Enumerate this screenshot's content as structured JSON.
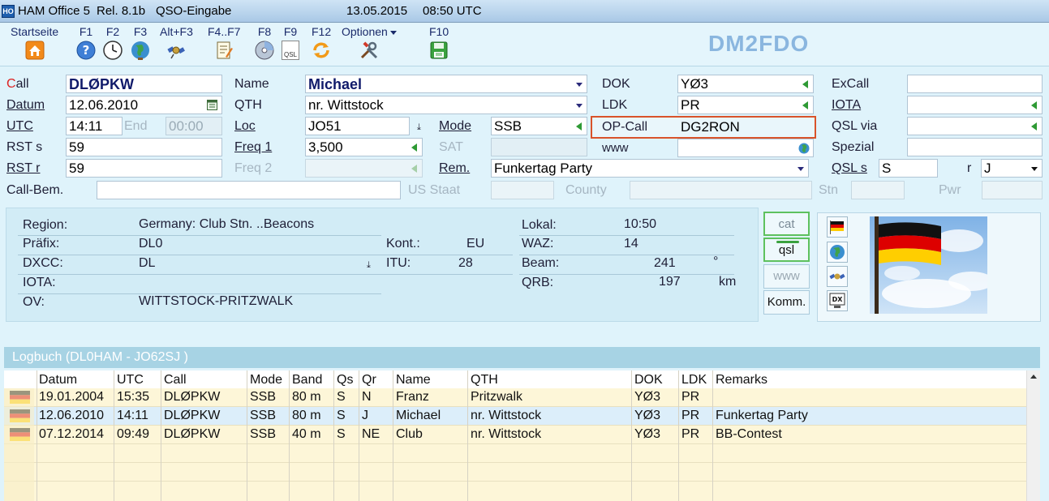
{
  "window": {
    "icon_text": "HO",
    "app": "HAM Office 5",
    "release": "Rel. 8.1b",
    "mode": "QSO-Eingabe",
    "date": "13.05.2015",
    "time": "08:50 UTC"
  },
  "toolbar": {
    "items": [
      {
        "label": "Startseite",
        "icon": "home-icon"
      },
      {
        "label": "F1",
        "icon": "help-icon"
      },
      {
        "label": "F2",
        "icon": "clock-icon"
      },
      {
        "label": "F3",
        "icon": "globe-icon"
      },
      {
        "label": "Alt+F3",
        "icon": "satellite-icon"
      },
      {
        "label": "F4..F7",
        "icon": "notepad-icon"
      },
      {
        "label": "F8",
        "icon": "cd-icon"
      },
      {
        "label": "F9",
        "icon": "qsl-card-icon",
        "icon_text": "QSL"
      },
      {
        "label": "F12",
        "icon": "refresh-icon"
      },
      {
        "label": "Optionen",
        "icon": "tools-icon"
      },
      {
        "label": "F10",
        "icon": "save-icon"
      }
    ],
    "station_callsign": "DM2FDO"
  },
  "form": {
    "call": {
      "label_prefix": "C",
      "label_rest": "all",
      "value": "DLØPKW"
    },
    "datum": {
      "label": "Datum",
      "value": "12.06.2010"
    },
    "utc": {
      "label": "UTC",
      "value": "14:11",
      "end_label": "End",
      "end_value": "00:00"
    },
    "rst_s": {
      "label": "RST s",
      "value": "59"
    },
    "rst_r": {
      "label": "RST r",
      "value": "59"
    },
    "call_bem": {
      "label": "Call-Bem.",
      "value": ""
    },
    "name": {
      "label": "Name",
      "value": "Michael"
    },
    "qth": {
      "label": "QTH",
      "value": "nr. Wittstock"
    },
    "loc": {
      "label": "Loc",
      "value": "JO51"
    },
    "freq1": {
      "label": "Freq 1",
      "value": "3,500"
    },
    "freq2": {
      "label": "Freq 2",
      "value": ""
    },
    "us_staat": {
      "label": "US Staat",
      "value": ""
    },
    "mode": {
      "label": "Mode",
      "value": "SSB"
    },
    "sat": {
      "label": "SAT",
      "value": ""
    },
    "rem": {
      "label": "Rem.",
      "value": "Funkertag Party"
    },
    "county": {
      "label": "County",
      "value": ""
    },
    "dok": {
      "label": "DOK",
      "value": "YØ3"
    },
    "ldk": {
      "label": "LDK",
      "value": "PR"
    },
    "op_call": {
      "label": "OP-Call",
      "value": "DG2RON"
    },
    "www": {
      "label": "www",
      "value": ""
    },
    "stn": {
      "label": "Stn",
      "value": ""
    },
    "excall": {
      "label": "ExCall",
      "value": ""
    },
    "iota": {
      "label": "IOTA",
      "value": ""
    },
    "qsl_via": {
      "label": "QSL via",
      "value": ""
    },
    "spezial": {
      "label": "Spezial",
      "value": ""
    },
    "qsl_s": {
      "label": "QSL s",
      "value": "S",
      "r_label": "r",
      "r_value": "J"
    },
    "pwr": {
      "label": "Pwr",
      "value": ""
    }
  },
  "info": {
    "region": {
      "label": "Region:",
      "value": "Germany: Club Stn. ..Beacons"
    },
    "praefix": {
      "label": "Präfix:",
      "value": "DL0"
    },
    "dxcc": {
      "label": "DXCC:",
      "value": "DL"
    },
    "iota": {
      "label": "IOTA:",
      "value": ""
    },
    "ov": {
      "label": "OV:",
      "value": "WITTSTOCK-PRITZWALK"
    },
    "kont": {
      "label": "Kont.:",
      "value": "EU"
    },
    "itu": {
      "label": "ITU:",
      "value": "28"
    },
    "lokal": {
      "label": "Lokal:",
      "value": "10:50"
    },
    "waz": {
      "label": "WAZ:",
      "value": "14"
    },
    "beam": {
      "label": "Beam:",
      "value": "241",
      "unit": "°"
    },
    "qrb": {
      "label": "QRB:",
      "value": "197",
      "unit": "km"
    }
  },
  "side_buttons": {
    "cat": "cat",
    "qsl": "qsl",
    "www": "www",
    "komm": "Komm."
  },
  "logbook": {
    "title": "Logbuch  (DL0HAM - JO62SJ )",
    "columns": [
      "Datum",
      "UTC",
      "Call",
      "Mode",
      "Band",
      "Qs",
      "Qr",
      "Name",
      "QTH",
      "DOK",
      "LDK",
      "Remarks"
    ],
    "rows": [
      [
        "19.01.2004",
        "15:35",
        "DLØPKW",
        "SSB",
        "80 m",
        "S",
        "N",
        "Franz",
        "Pritzwalk",
        "YØ3",
        "PR",
        ""
      ],
      [
        "12.06.2010",
        "14:11",
        "DLØPKW",
        "SSB",
        "80 m",
        "S",
        "J",
        "Michael",
        "nr. Wittstock",
        "YØ3",
        "PR",
        "Funkertag Party"
      ],
      [
        "07.12.2014",
        "09:49",
        "DLØPKW",
        "SSB",
        "40 m",
        "S",
        "NE",
        "Club",
        "nr. Wittstock",
        "YØ3",
        "PR",
        "BB-Contest"
      ]
    ]
  },
  "colors": {
    "accent": "#8ab6df",
    "row_bg": "#fdf6d8",
    "selected_row": "#dceefa",
    "op_call_border": "#d9532a"
  }
}
